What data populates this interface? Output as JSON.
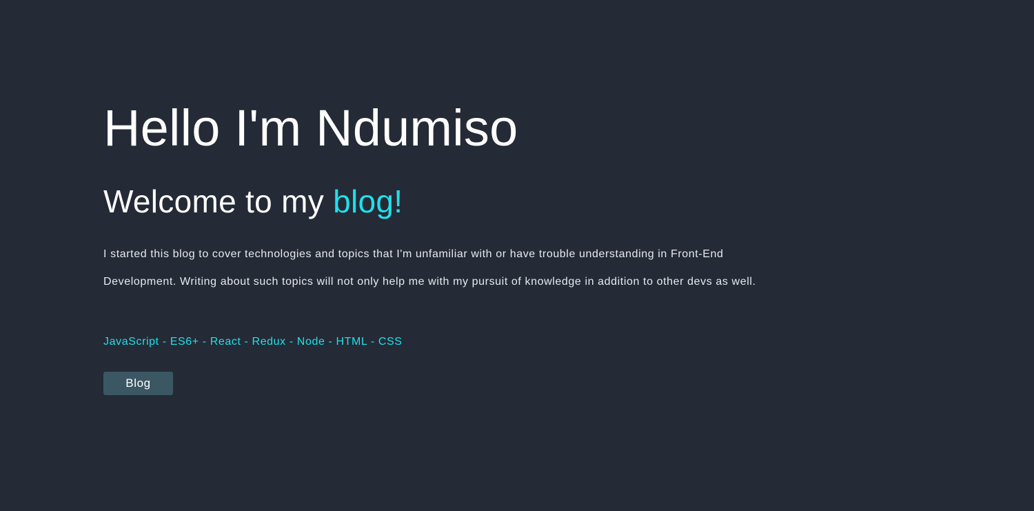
{
  "hero": {
    "greeting": "Hello I'm Ndumiso",
    "welcome_prefix": "Welcome to my ",
    "welcome_accent": "blog!",
    "intro": "I started this blog to cover technologies and topics that I'm unfamiliar with or have trouble understanding in Front-End Development. Writing about such topics will not only help me with my pursuit of knowledge in addition to other devs as well.",
    "tech_list": "JavaScript - ES6+ - React - Redux - Node - HTML - CSS",
    "button_label": "Blog"
  },
  "colors": {
    "background": "#242a36",
    "text": "#ffffff",
    "accent": "#1fe0ea",
    "button_bg": "#3b5763"
  }
}
